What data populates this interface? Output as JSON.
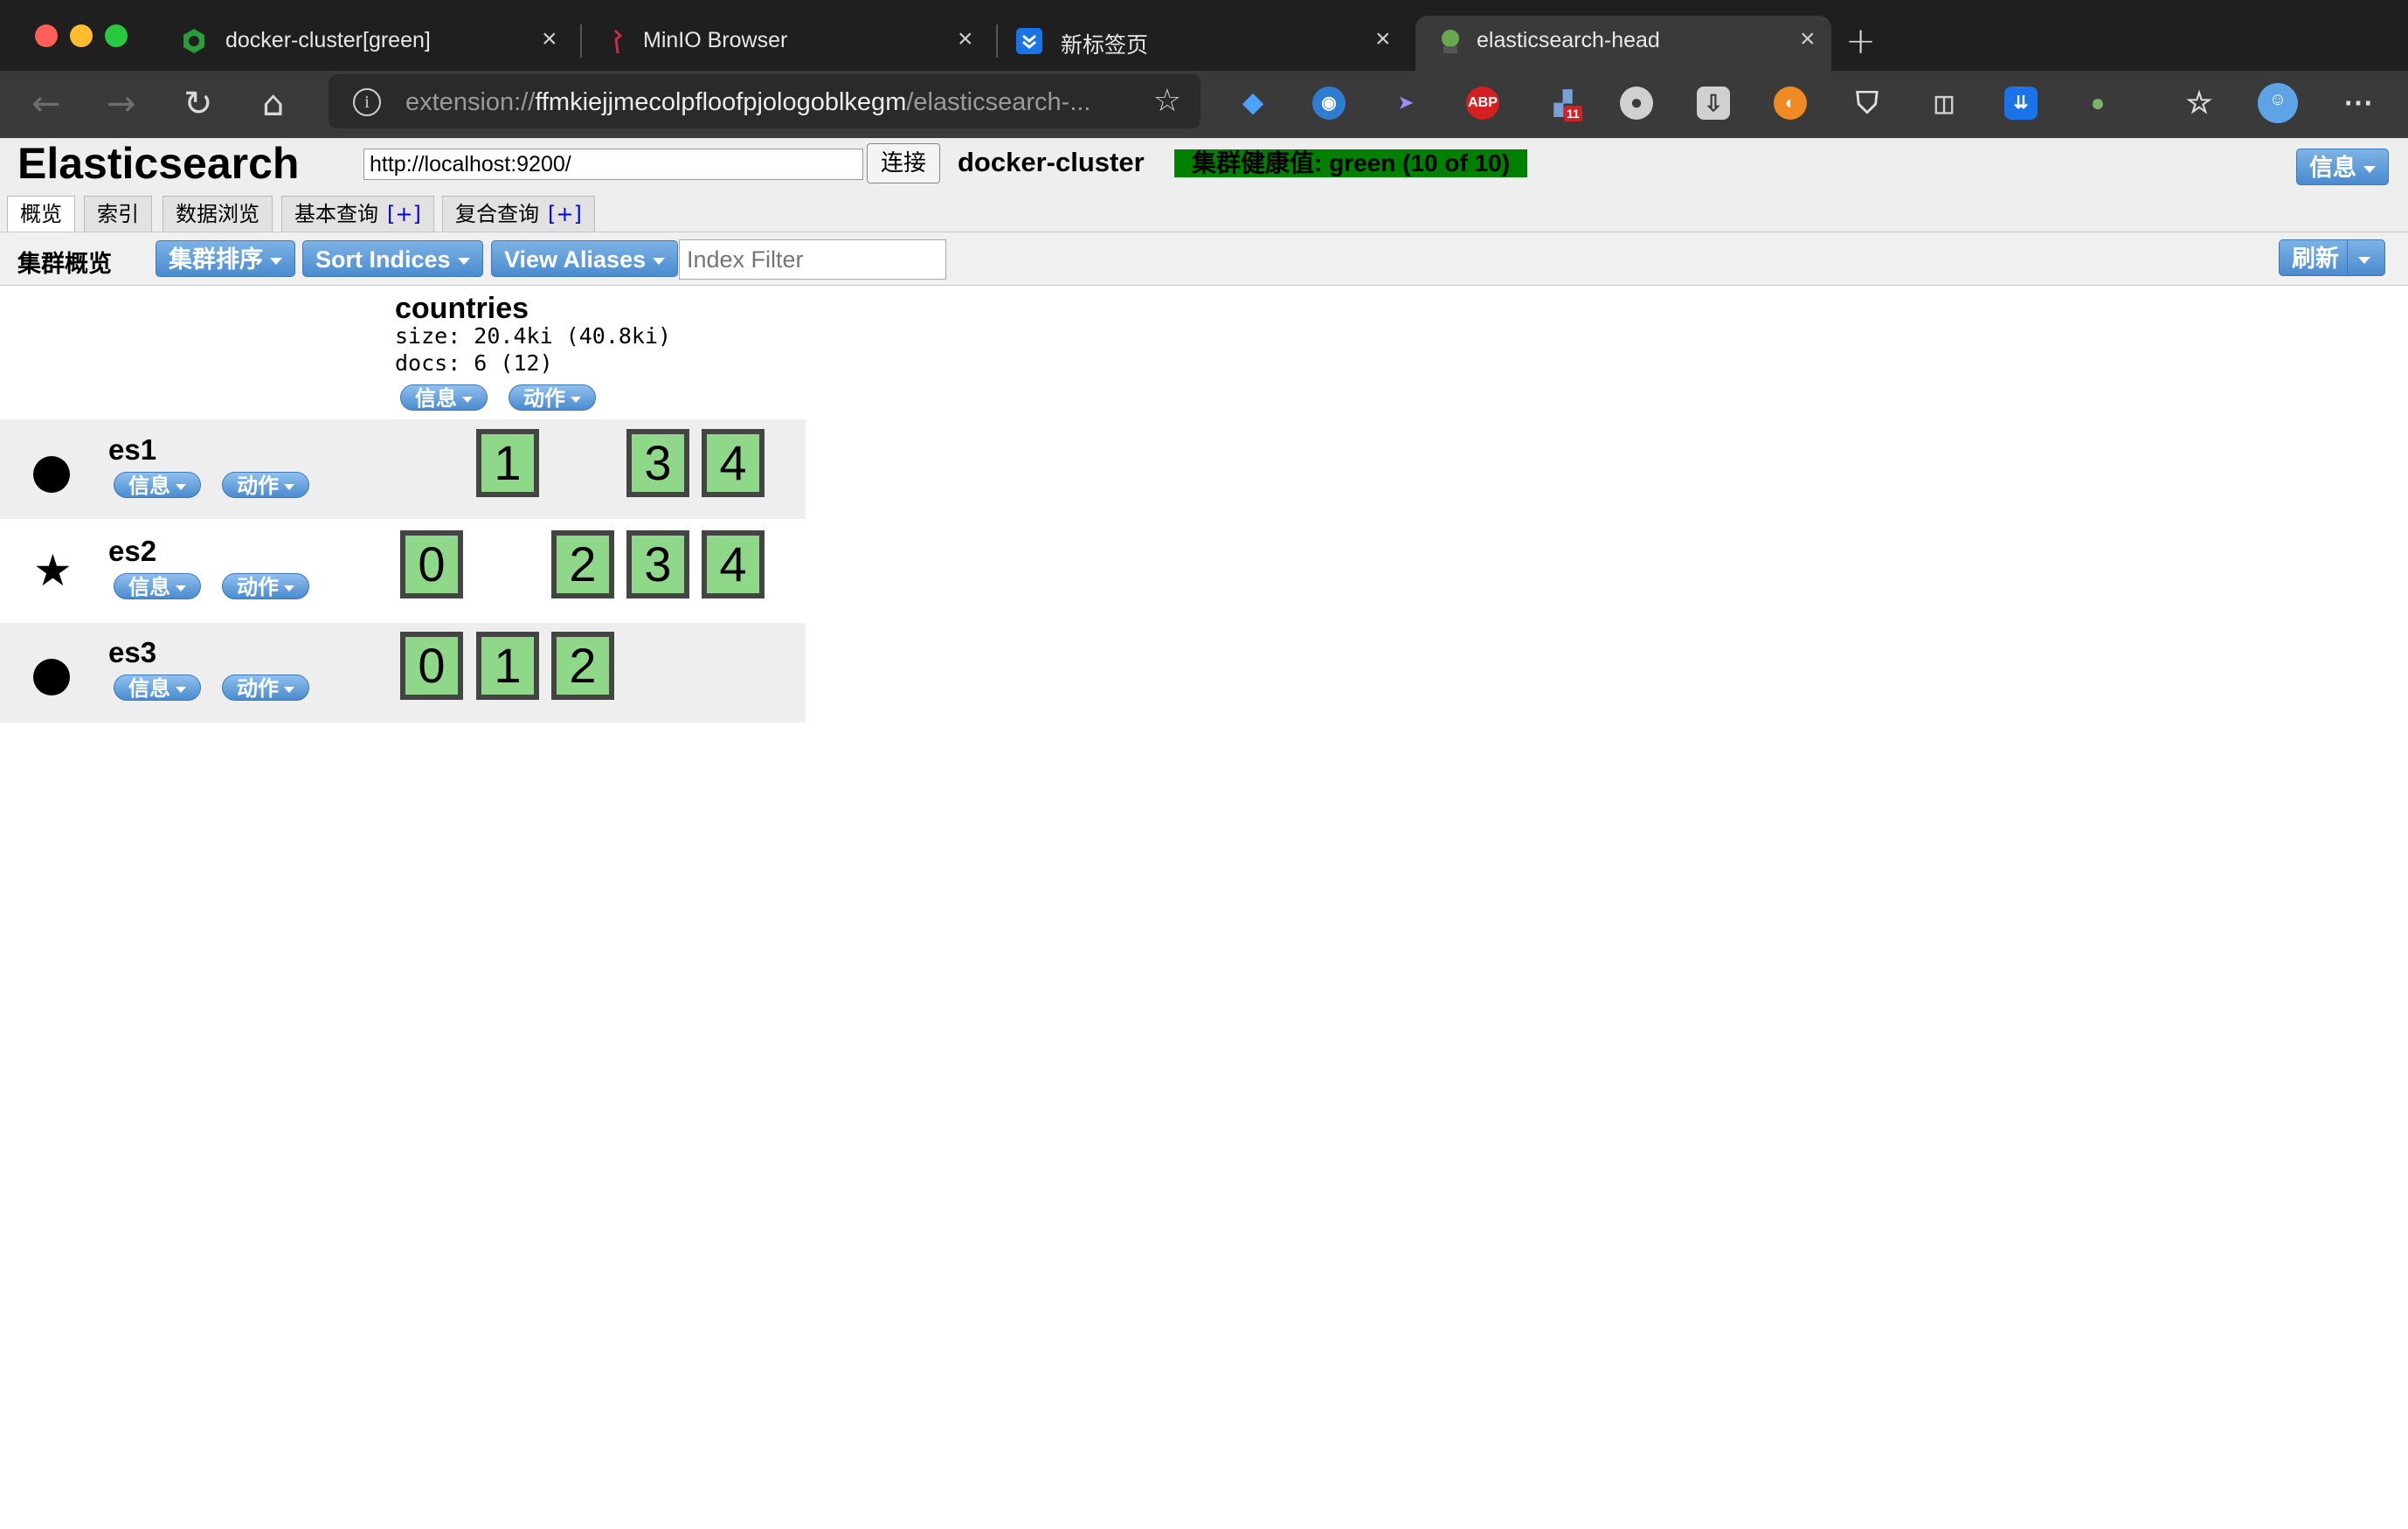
{
  "browser": {
    "tabs": [
      {
        "title": "docker-cluster[green]",
        "active": false
      },
      {
        "title": "MinIO Browser",
        "active": false
      },
      {
        "title": "新标签页",
        "active": false
      },
      {
        "title": "elasticsearch-head",
        "active": true
      }
    ],
    "address": {
      "scheme": "extension://",
      "host": "ffmkiejjmecolpfloofpjologoblkegm",
      "path": "/elasticsearch-..."
    },
    "extensions": [
      "ABP",
      "11"
    ]
  },
  "app": {
    "title": "Elasticsearch",
    "connect_url": "http://localhost:9200/",
    "connect_label": "连接",
    "cluster_name": "docker-cluster",
    "health_text": "集群健康值: green (10 of 10)",
    "info_label": "信息",
    "tabs": [
      {
        "label": "概览",
        "plus": ""
      },
      {
        "label": "索引",
        "plus": ""
      },
      {
        "label": "数据浏览",
        "plus": ""
      },
      {
        "label": "基本查询",
        "plus": "[+]"
      },
      {
        "label": "复合查询",
        "plus": "[+]"
      }
    ],
    "subbar": {
      "title": "集群概览",
      "sort_cluster": "集群排序",
      "sort_indices": "Sort Indices",
      "view_aliases": "View Aliases",
      "filter_placeholder": "Index Filter",
      "refresh": "刷新"
    },
    "index": {
      "name": "countries",
      "size": "size: 20.4ki (40.8ki)",
      "docs": "docs: 6 (12)",
      "info": "信息",
      "actions": "动作"
    },
    "nodes": [
      {
        "name": "es1",
        "master": false,
        "info": "信息",
        "actions": "动作",
        "shards": [
          "",
          "1",
          "",
          "3",
          "4"
        ]
      },
      {
        "name": "es2",
        "master": true,
        "info": "信息",
        "actions": "动作",
        "shards": [
          "0",
          "",
          "2",
          "3",
          "4"
        ]
      },
      {
        "name": "es3",
        "master": false,
        "info": "信息",
        "actions": "动作",
        "shards": [
          "0",
          "1",
          "2",
          "",
          ""
        ]
      }
    ],
    "colors": {
      "health": "#008000",
      "shard": "#8fd88a",
      "button": "#4a8bcf"
    }
  }
}
